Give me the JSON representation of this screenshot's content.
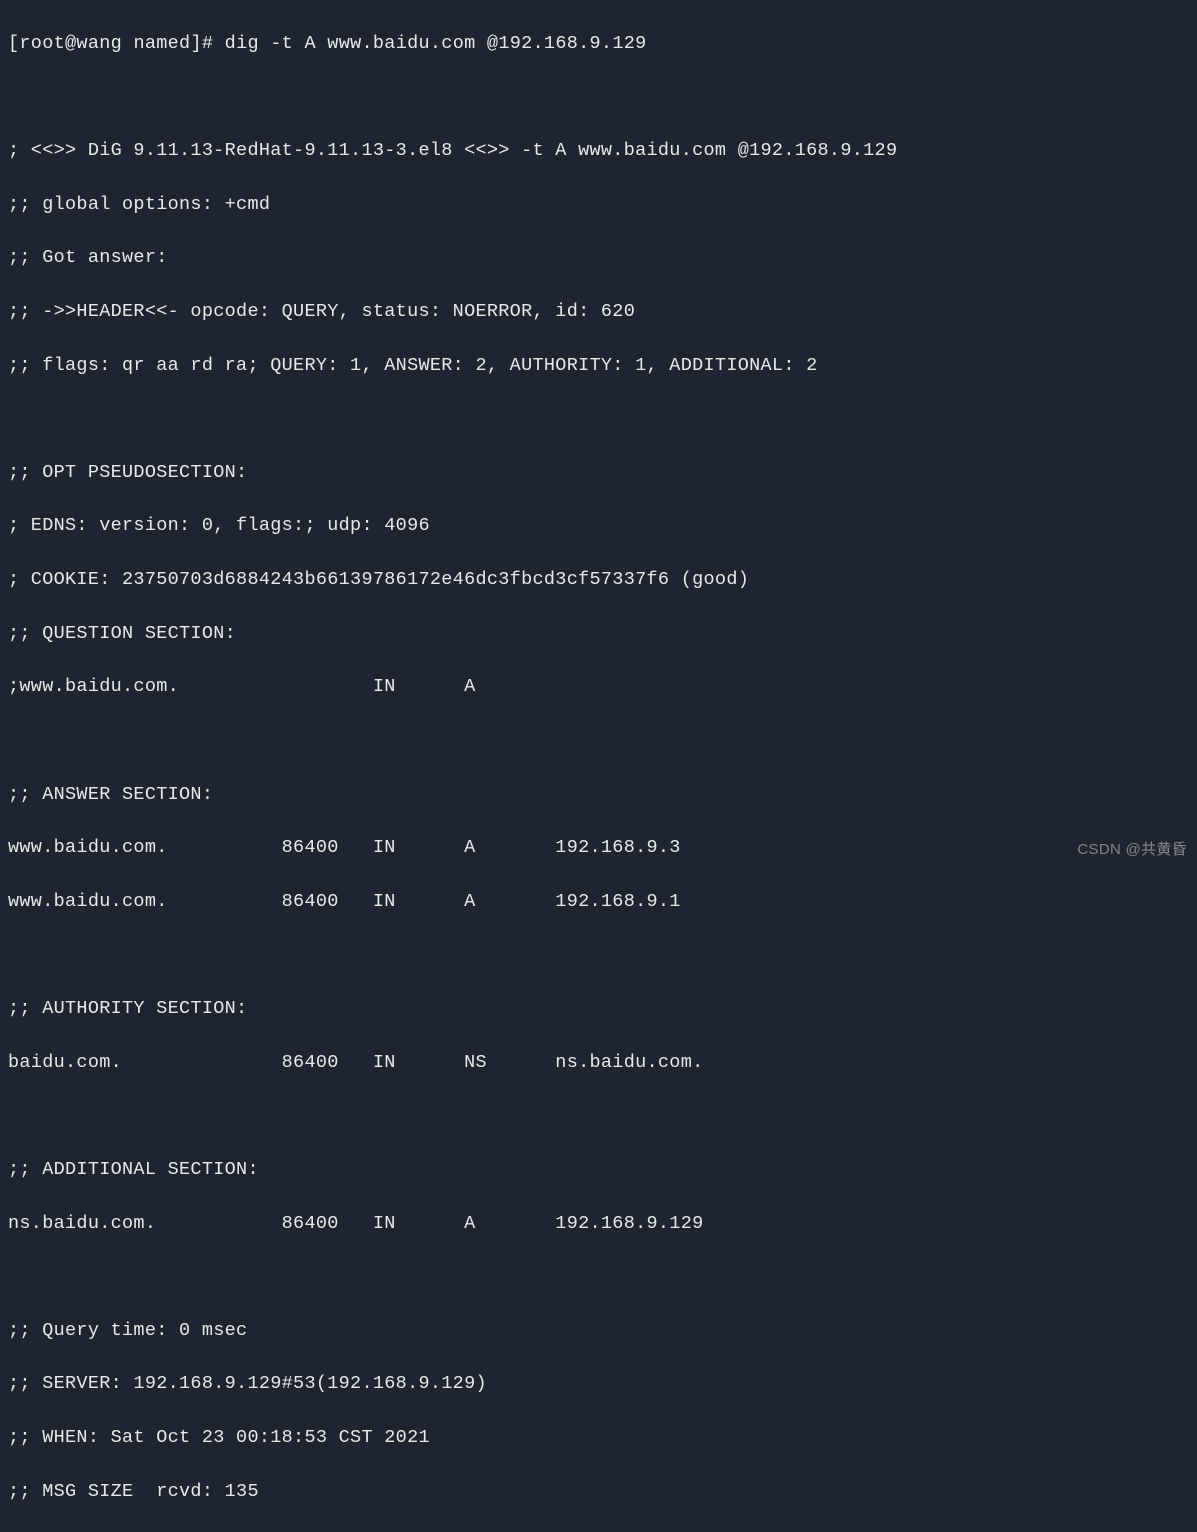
{
  "prompt": {
    "user": "root",
    "host": "wang",
    "cwd": "named",
    "symbol": "#",
    "command": "dig -t A www.baidu.com @192.168.9.129"
  },
  "header": {
    "banner": "; <<>> DiG 9.11.13-RedHat-9.11.13-3.el8 <<>> -t A www.baidu.com @192.168.9.129",
    "global_options": ";; global options: +cmd",
    "got_answer": ";; Got answer:",
    "header_line": ";; ->>HEADER<<- opcode: QUERY, status: NOERROR, id: 620",
    "flags": ";; flags: qr aa rd ra; QUERY: 1, ANSWER: 2, AUTHORITY: 1, ADDITIONAL: 2"
  },
  "opt_section": {
    "title": ";; OPT PSEUDOSECTION:",
    "edns": "; EDNS: version: 0, flags:; udp: 4096",
    "cookie": "; COOKIE: 23750703d6884243b66139786172e46dc3fbcd3cf57337f6 (good)"
  },
  "question_section": {
    "title": ";; QUESTION SECTION:",
    "row": ";www.baidu.com.                 IN      A"
  },
  "answer_section": {
    "title": ";; ANSWER SECTION:",
    "rows": [
      "www.baidu.com.          86400   IN      A       192.168.9.3",
      "www.baidu.com.          86400   IN      A       192.168.9.1"
    ]
  },
  "authority_section": {
    "title": ";; AUTHORITY SECTION:",
    "row": "baidu.com.              86400   IN      NS      ns.baidu.com."
  },
  "additional_section": {
    "title": ";; ADDITIONAL SECTION:",
    "row": "ns.baidu.com.           86400   IN      A       192.168.9.129"
  },
  "footer": {
    "query_time": ";; Query time: 0 msec",
    "server": ";; SERVER: 192.168.9.129#53(192.168.9.129)",
    "when": ";; WHEN: Sat Oct 23 00:18:53 CST 2021",
    "msg_size": ";; MSG SIZE  rcvd: 135"
  },
  "watermark": "CSDN @共黄昏"
}
